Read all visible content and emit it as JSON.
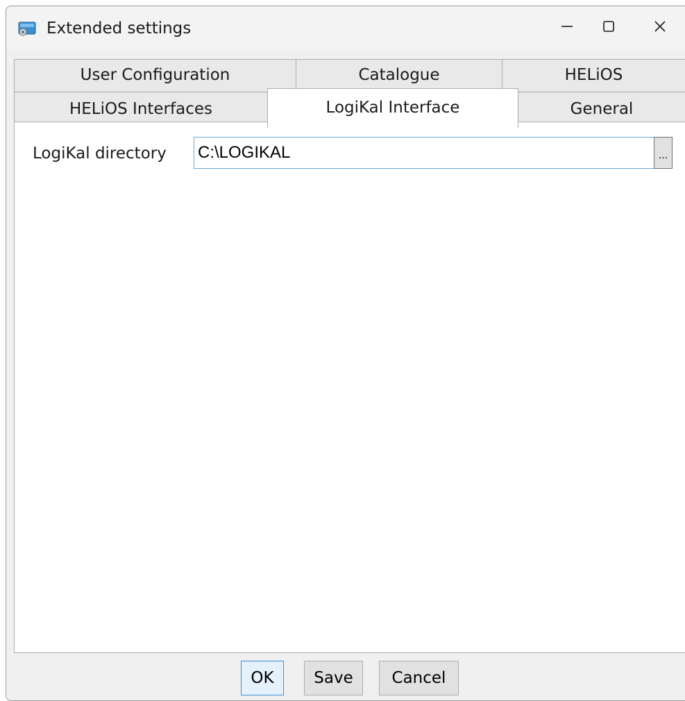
{
  "window": {
    "title": "Extended settings",
    "app_icon": "settings-app-icon",
    "controls": {
      "minimize_icon": "minimize-icon",
      "maximize_icon": "maximize-icon",
      "close_icon": "close-icon"
    }
  },
  "tabs": {
    "row1": [
      {
        "label": "User Configuration"
      },
      {
        "label": "Catalogue"
      },
      {
        "label": "HELiOS"
      }
    ],
    "row2": [
      {
        "label": "HELiOS Interfaces"
      },
      {
        "label": "LogiKal Interface",
        "selected": true
      },
      {
        "label": "General"
      }
    ]
  },
  "panel": {
    "directory_label": "LogiKal directory",
    "directory_value": "C:\\LOGIKAL",
    "browse_label": "..."
  },
  "buttons": {
    "ok_label": "OK",
    "save_label": "Save",
    "cancel_label": "Cancel"
  },
  "colors": {
    "window_bg": "#f0f0f0",
    "panel_bg": "#ffffff",
    "focus_border": "#3c8fd8"
  }
}
